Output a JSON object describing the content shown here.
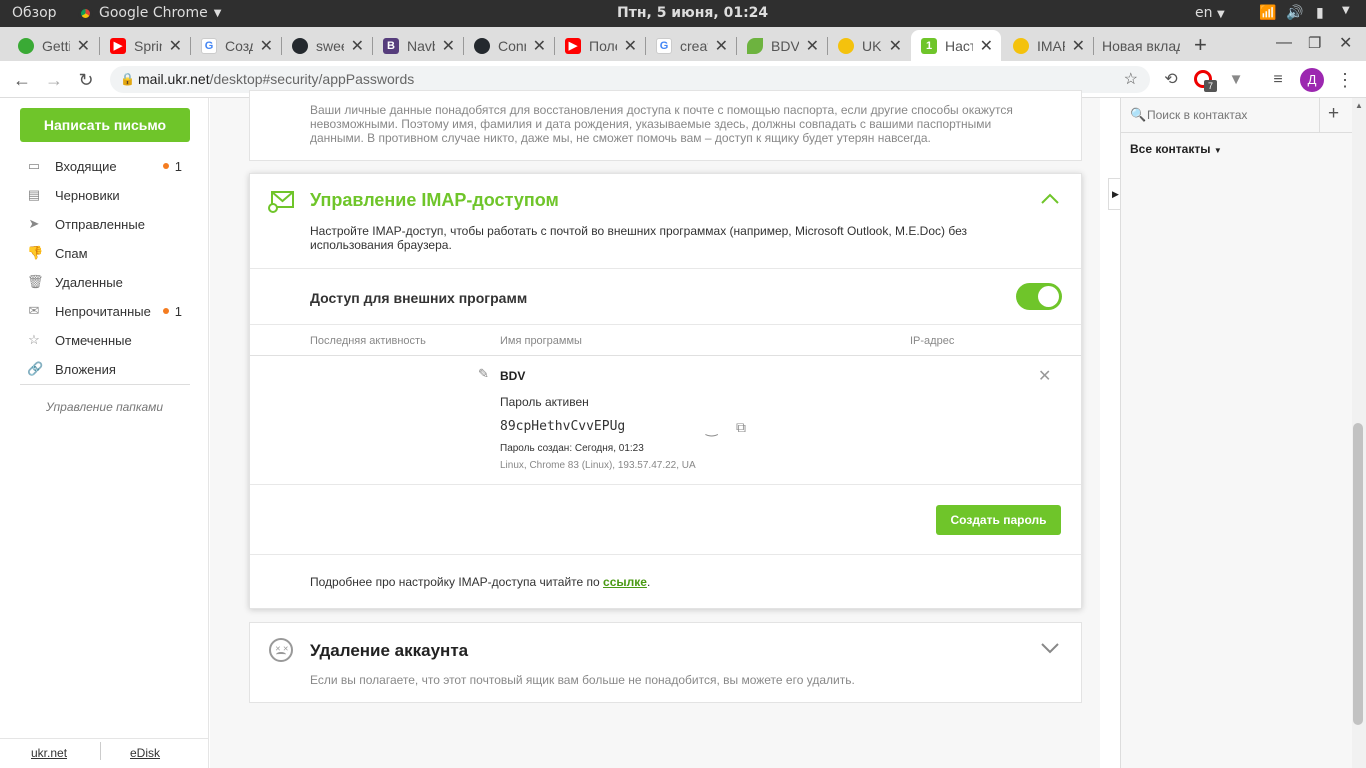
{
  "os": {
    "overview": "Обзор",
    "app_name": "Google Chrome",
    "clock": "Птн, 5 июня, 01:24",
    "lang": "en"
  },
  "tabs": [
    {
      "label": "Getting",
      "color": "#3aaa35"
    },
    {
      "label": "Spring",
      "color": "#ff0000"
    },
    {
      "label": "Создание",
      "color": "#4285f4"
    },
    {
      "label": "sweetalert",
      "color": "#24292e"
    },
    {
      "label": "Navbar",
      "color": "#563d7c"
    },
    {
      "label": "Connect",
      "color": "#24292e"
    },
    {
      "label": "Полезное",
      "color": "#ff0000"
    },
    {
      "label": "create",
      "color": "#4285f4"
    },
    {
      "label": "BDV",
      "color": "#6db33f"
    },
    {
      "label": "UKR.NET",
      "color": "#f4c20d"
    },
    {
      "label": "Настройки",
      "color": "#6fc52a"
    },
    {
      "label": "IMAP",
      "color": "#f4c20d"
    },
    {
      "label": "Новая вкладка",
      "color": ""
    }
  ],
  "browser": {
    "url_host": "mail.ukr.net",
    "url_path": "/desktop#security/appPasswords",
    "ext_badge": "7",
    "profile_initial": "Д"
  },
  "sidebar": {
    "compose": "Написать письмо",
    "folders": [
      {
        "label": "Входящие",
        "icon": "inbox-icon",
        "count": "1"
      },
      {
        "label": "Черновики",
        "icon": "drafts-icon",
        "count": ""
      },
      {
        "label": "Отправленные",
        "icon": "sent-icon",
        "count": ""
      },
      {
        "label": "Спам",
        "icon": "spam-icon",
        "count": ""
      },
      {
        "label": "Удаленные",
        "icon": "trash-icon",
        "count": ""
      },
      {
        "label": "Непрочитанные",
        "icon": "unread-icon",
        "count": "1"
      },
      {
        "label": "Отмеченные",
        "icon": "star-icon",
        "count": ""
      },
      {
        "label": "Вложения",
        "icon": "attachment-icon",
        "count": ""
      }
    ],
    "manage": "Управление папками",
    "footer": {
      "ukrnet": "ukr.net",
      "edisk": "eDisk"
    }
  },
  "passport_card": {
    "text": "Ваши личные данные понадобятся для восстановления доступа к почте с помощью паспорта, если другие способы окажутся невозможными. Поэтому имя, фамилия и дата рождения, указываемые здесь, должны совпадать с вашими паспортными данными. В противном случае никто, даже мы, не сможет помочь вам – доступ к ящику будет утерян навсегда."
  },
  "imap": {
    "title": "Управление IMAP-доступом",
    "description": "Настройте IMAP-доступ, чтобы работать с почтой во внешних программах (например, Microsoft Outlook, M.E.Doc) без использования браузера.",
    "access_label": "Доступ для внешних программ",
    "access_enabled": true,
    "columns": [
      "Последняя активность",
      "Имя программы",
      "IP-адрес"
    ],
    "app": {
      "name": "BDV",
      "status": "Пароль активен",
      "password": "89cpHethvCvvEPUg",
      "created": "Пароль создан: Сегодня, 01:23",
      "info": "Linux, Chrome 83 (Linux), 193.57.47.22, UA"
    },
    "create_button": "Создать пароль",
    "more_prefix": "Подробнее про настройку IMAP-доступа читайте по ",
    "more_link": "ссылке",
    "more_suffix": "."
  },
  "delete_account": {
    "title": "Удаление аккаунта",
    "text": "Если вы полагаете, что этот почтовый ящик вам больше не понадобится, вы можете его удалить."
  },
  "contacts": {
    "search_placeholder": "Поиск в контактах",
    "all_contacts": "Все контакты"
  },
  "colors": {
    "accent": "#6fc52a",
    "link": "#4a9a14"
  }
}
